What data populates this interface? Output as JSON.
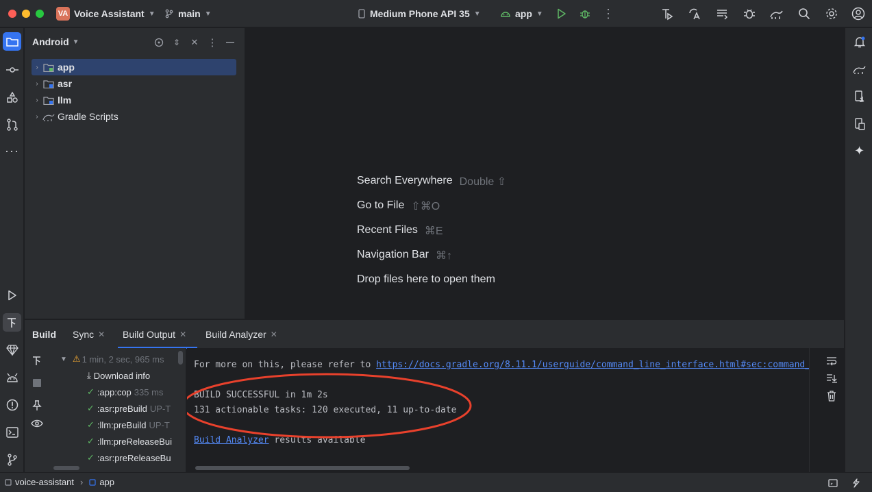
{
  "title_bar": {
    "project_badge": "VA",
    "project_name": "Voice Assistant",
    "branch": "main",
    "device": "Medium Phone API 35",
    "run_config": "app"
  },
  "project_panel": {
    "view_mode": "Android",
    "tree": [
      {
        "label": "app",
        "selected": true
      },
      {
        "label": "asr",
        "selected": false
      },
      {
        "label": "llm",
        "selected": false
      },
      {
        "label": "Gradle Scripts",
        "selected": false
      }
    ]
  },
  "editor_hints": [
    {
      "label": "Search Everywhere",
      "shortcut": "Double ⇧"
    },
    {
      "label": "Go to File",
      "shortcut": "⇧⌘O"
    },
    {
      "label": "Recent Files",
      "shortcut": "⌘E"
    },
    {
      "label": "Navigation Bar",
      "shortcut": "⌘↑"
    },
    {
      "label": "Drop files here to open them",
      "shortcut": ""
    }
  ],
  "build_panel": {
    "title": "Build",
    "tabs": [
      "Sync",
      "Build Output",
      "Build Analyzer"
    ],
    "active_tab": "Build Output",
    "tree": {
      "root_time": "1 min, 2 sec, 965 ms",
      "items": [
        {
          "label": "Download info",
          "detail": ""
        },
        {
          "label": ":app:cop",
          "detail": "335 ms"
        },
        {
          "label": ":asr:preBuild",
          "detail": "UP-T"
        },
        {
          "label": ":llm:preBuild",
          "detail": "UP-T"
        },
        {
          "label": ":llm:preReleaseBui",
          "detail": ""
        },
        {
          "label": ":asr:preReleaseBu",
          "detail": ""
        }
      ]
    },
    "console": {
      "line1_prefix": "For more on this, please refer to ",
      "line1_link": "https://docs.gradle.org/8.11.1/userguide/command_line_interface.html#sec:command_",
      "line2": "BUILD SUCCESSFUL in 1m 2s",
      "line3": "131 actionable tasks: 120 executed, 11 up-to-date",
      "line4_link": "Build Analyzer",
      "line4_suffix": " results available"
    }
  },
  "status_bar": {
    "crumbs": [
      "voice-assistant",
      "app"
    ]
  },
  "colors": {
    "accent": "#3574f0",
    "success": "#5fb865",
    "annotation": "#e8412c"
  }
}
